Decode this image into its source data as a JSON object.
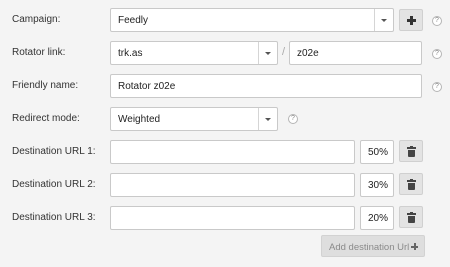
{
  "campaign": {
    "label": "Campaign:",
    "value": "Feedly",
    "help": "?"
  },
  "rotator_link": {
    "label": "Rotator link:",
    "domain": "trk.as",
    "separator": "/",
    "path": "z02e",
    "help": "?"
  },
  "friendly_name": {
    "label": "Friendly name:",
    "value": "Rotator z02e",
    "help": "?"
  },
  "redirect_mode": {
    "label": "Redirect mode:",
    "value": "Weighted",
    "help": "?"
  },
  "destinations": [
    {
      "label": "Destination URL 1:",
      "url": "",
      "weight": "50%"
    },
    {
      "label": "Destination URL 2:",
      "url": "",
      "weight": "30%"
    },
    {
      "label": "Destination URL 3:",
      "url": "",
      "weight": "20%"
    }
  ],
  "add_destination_label": "Add destination Url",
  "icons": {
    "add_campaign": "plus-icon",
    "delete": "trash-icon",
    "help": "question-mark-icon",
    "dropdown": "chevron-down-icon"
  }
}
